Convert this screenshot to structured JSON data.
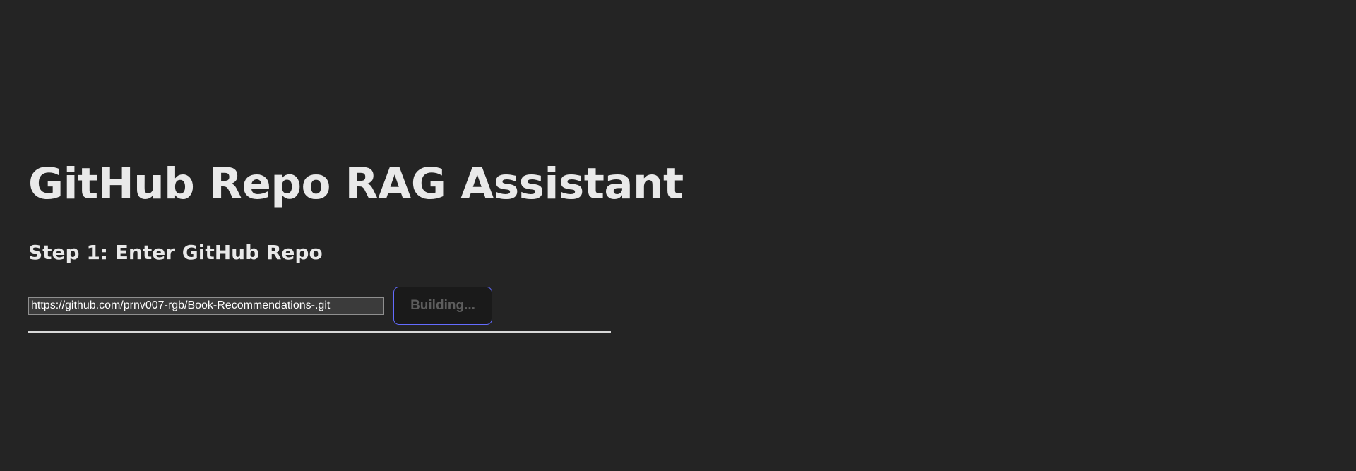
{
  "app": {
    "title": "GitHub Repo RAG Assistant"
  },
  "step1": {
    "title": "Step 1: Enter GitHub Repo",
    "repo_input": {
      "value": "https://github.com/prnv007-rgb/Book-Recommendations-.git"
    },
    "build_button": {
      "label": "Building...",
      "disabled": true
    }
  },
  "colors": {
    "background": "#242424",
    "text": "#e6e6e6",
    "button_border": "#646cff",
    "button_background": "#1a1a1a",
    "button_text_disabled": "#5d5d5d",
    "input_background": "#3b3b3b"
  }
}
